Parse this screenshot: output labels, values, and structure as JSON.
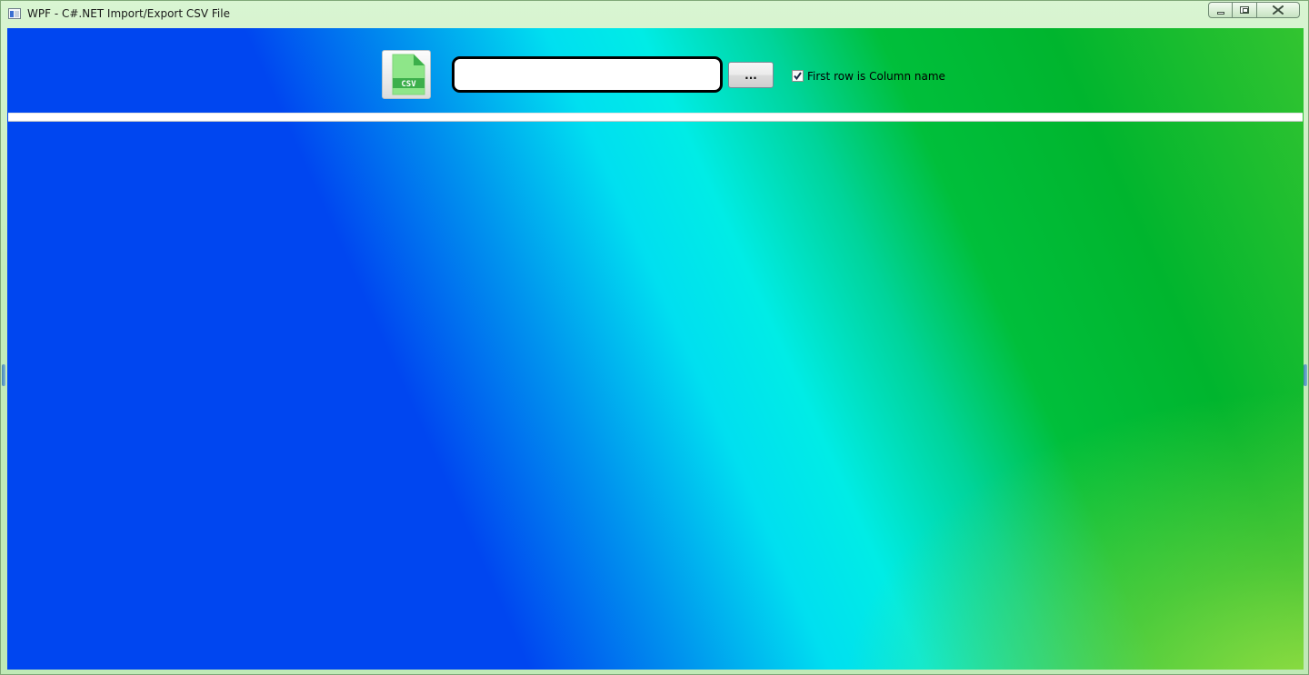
{
  "window": {
    "title": "WPF - C#.NET Import/Export CSV File"
  },
  "toolbar": {
    "csv_icon_label": "CSV",
    "path_input_value": "",
    "browse_label": "...",
    "first_row_checkbox": {
      "label": "First row is Column name",
      "checked": true
    }
  },
  "icons": {
    "app": "window-app-icon",
    "csv": "csv-file-icon",
    "minimize": "minimize-icon",
    "maximize": "maximize-icon",
    "close": "close-icon",
    "check": "checkmark-icon"
  },
  "colors": {
    "gradient_blue": "#0046F0",
    "gradient_cyan": "#00E6F0",
    "gradient_green": "#00B52E",
    "gradient_lime": "#8CD740",
    "csv_icon_green": "#3CAF4B"
  }
}
